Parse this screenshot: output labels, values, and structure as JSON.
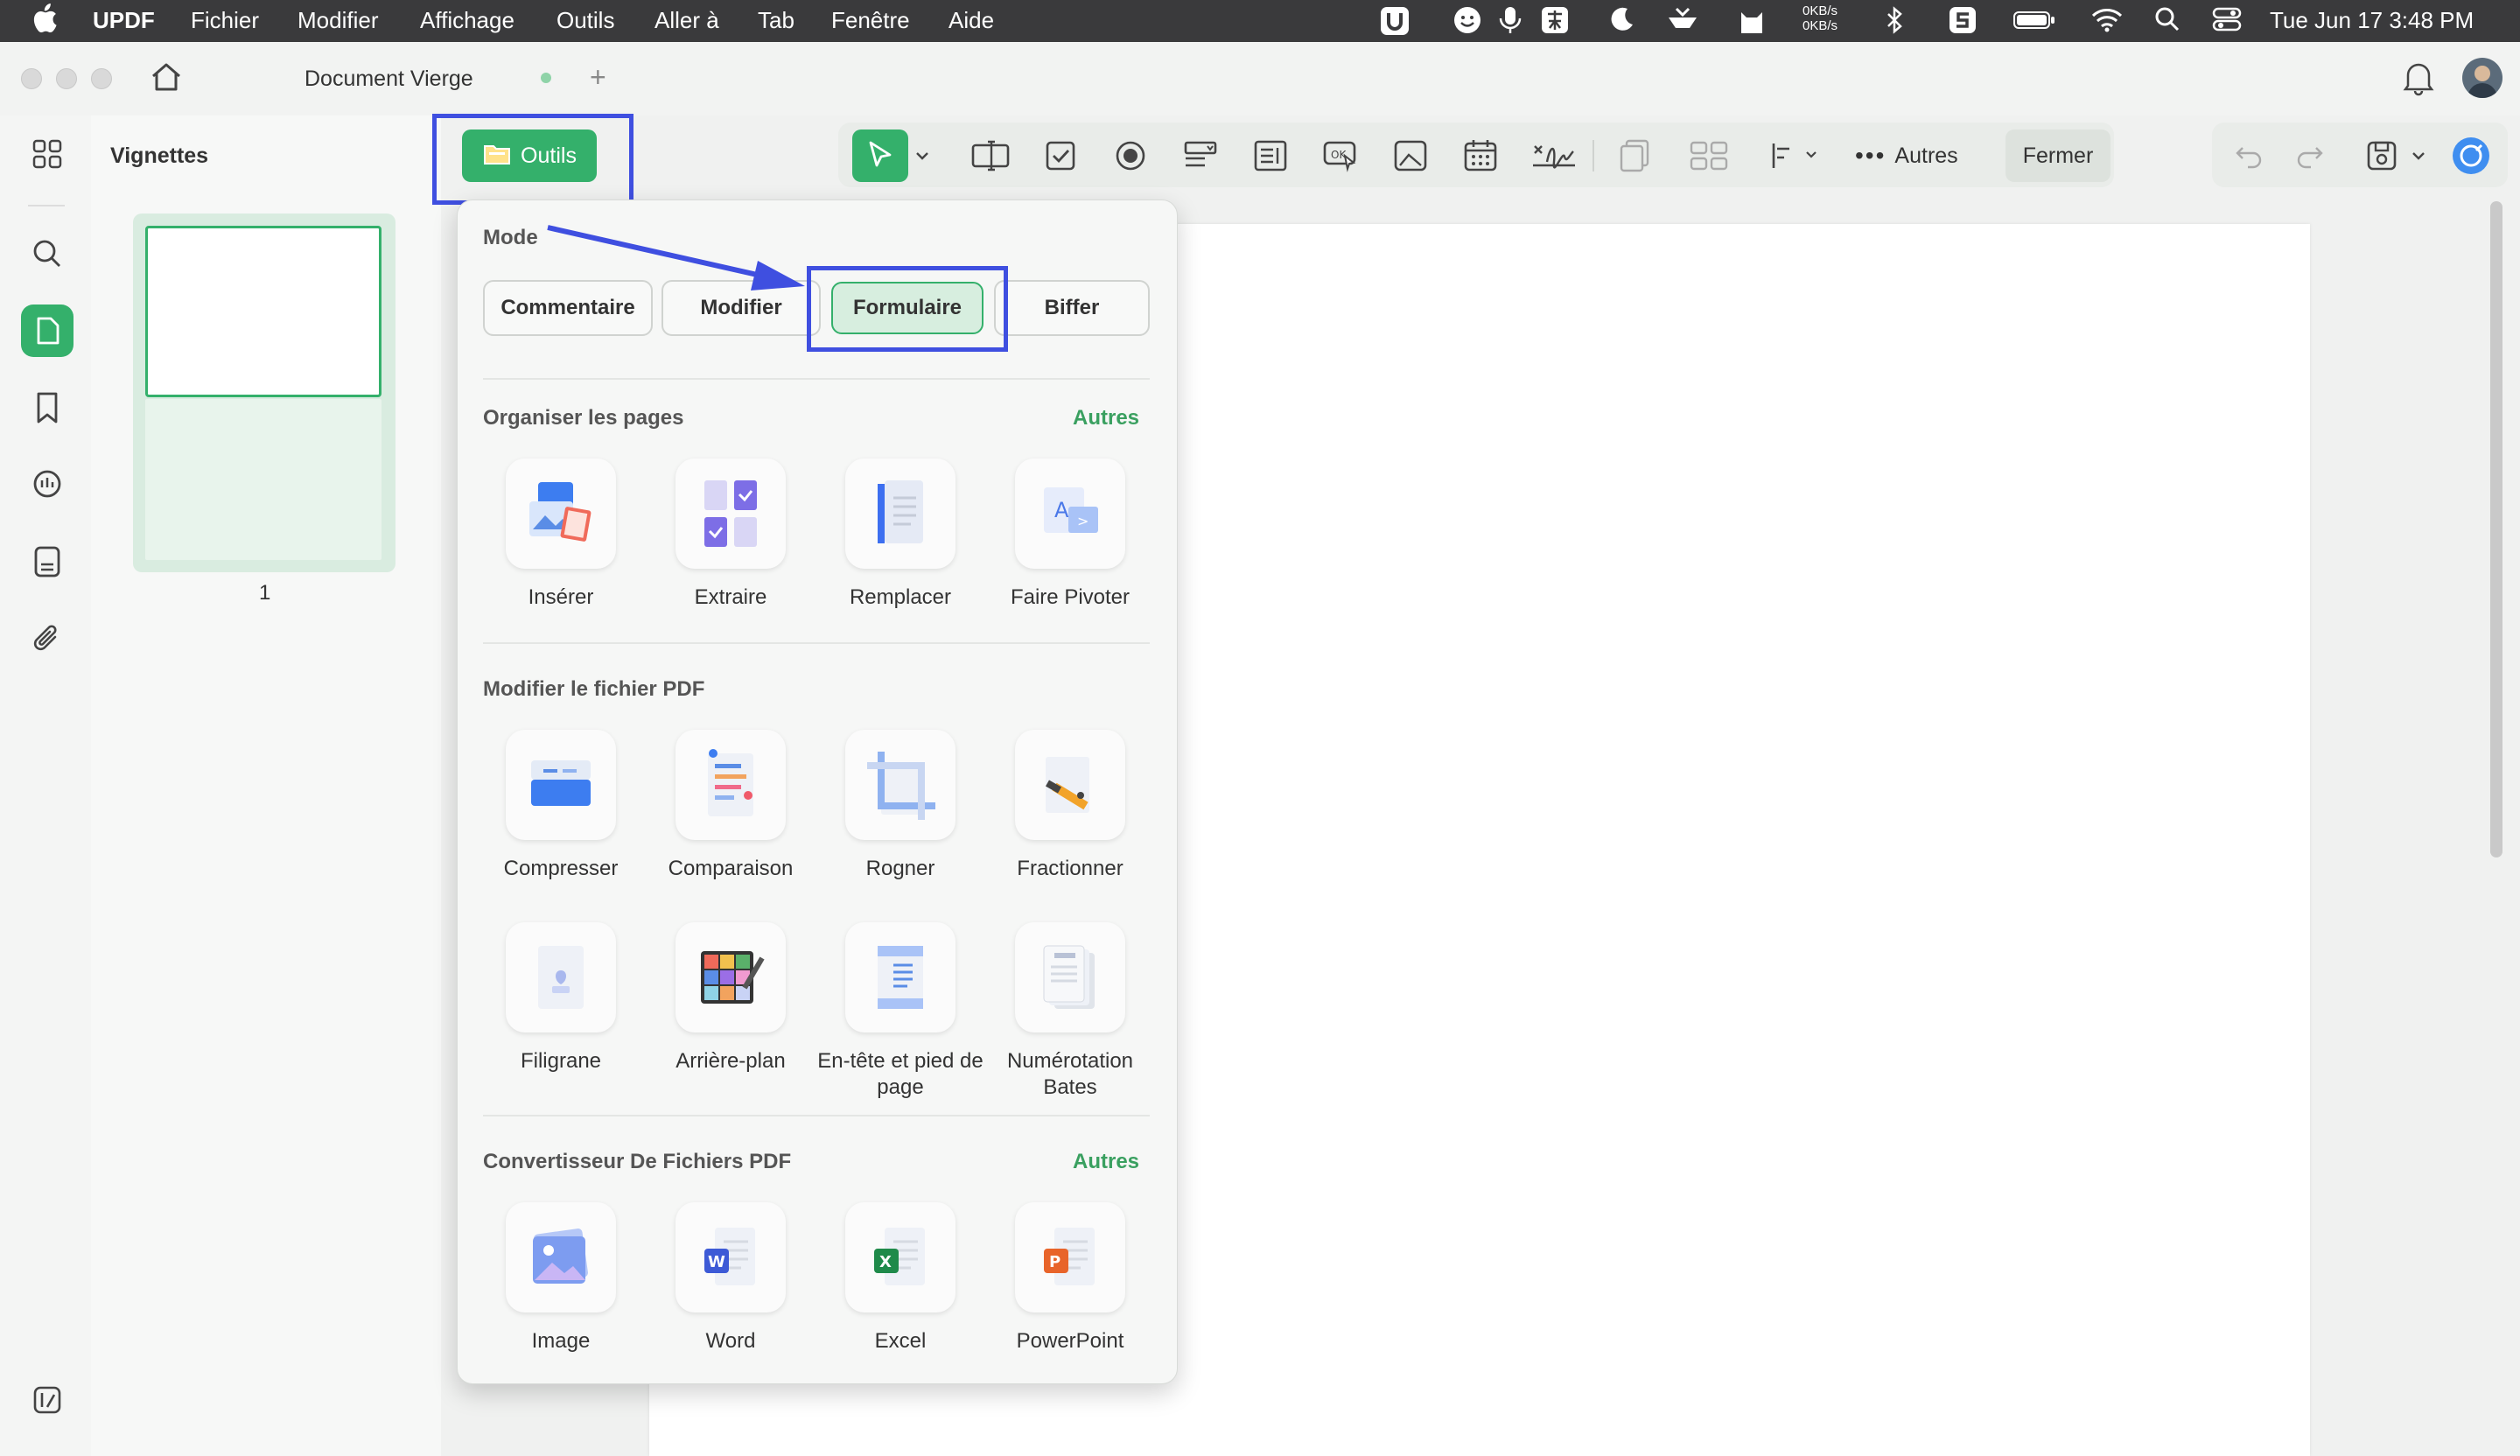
{
  "menubar": {
    "apple": "",
    "app_name": "UPDF",
    "items": [
      "Fichier",
      "Modifier",
      "Affichage",
      "Outils",
      "Aller à",
      "Tab",
      "Fenêtre",
      "Aide"
    ],
    "net_up": "0KB/s",
    "net_down": "0KB/s",
    "datetime": "Tue Jun 17  3:48 PM"
  },
  "window": {
    "tab_title": "Document Vierge"
  },
  "sidebar": {
    "panel_title": "Vignettes",
    "page_number": "1"
  },
  "toolbar": {
    "outils_label": "Outils",
    "autres_label": "Autres",
    "fermer_label": "Fermer"
  },
  "popup": {
    "mode_title": "Mode",
    "modes": [
      "Commentaire",
      "Modifier",
      "Formulaire",
      "Biffer"
    ],
    "selected_mode": "Formulaire",
    "organize_title": "Organiser les pages",
    "organize_more": "Autres",
    "organize_tools": [
      "Insérer",
      "Extraire",
      "Remplacer",
      "Faire Pivoter"
    ],
    "edit_title": "Modifier le fichier PDF",
    "edit_tools_row1": [
      "Compresser",
      "Comparaison",
      "Rogner",
      "Fractionner"
    ],
    "edit_tools_row2": [
      "Filigrane",
      "Arrière-plan",
      "En-tête et pied de page",
      "Numérotation Bates"
    ],
    "convert_title": "Convertisseur De Fichiers PDF",
    "convert_more": "Autres",
    "convert_tools": [
      "Image",
      "Word",
      "Excel",
      "PowerPoint"
    ]
  },
  "colors": {
    "accent": "#34b06b",
    "highlight": "#3f4fe0",
    "menubar": "#3a3a3c"
  }
}
